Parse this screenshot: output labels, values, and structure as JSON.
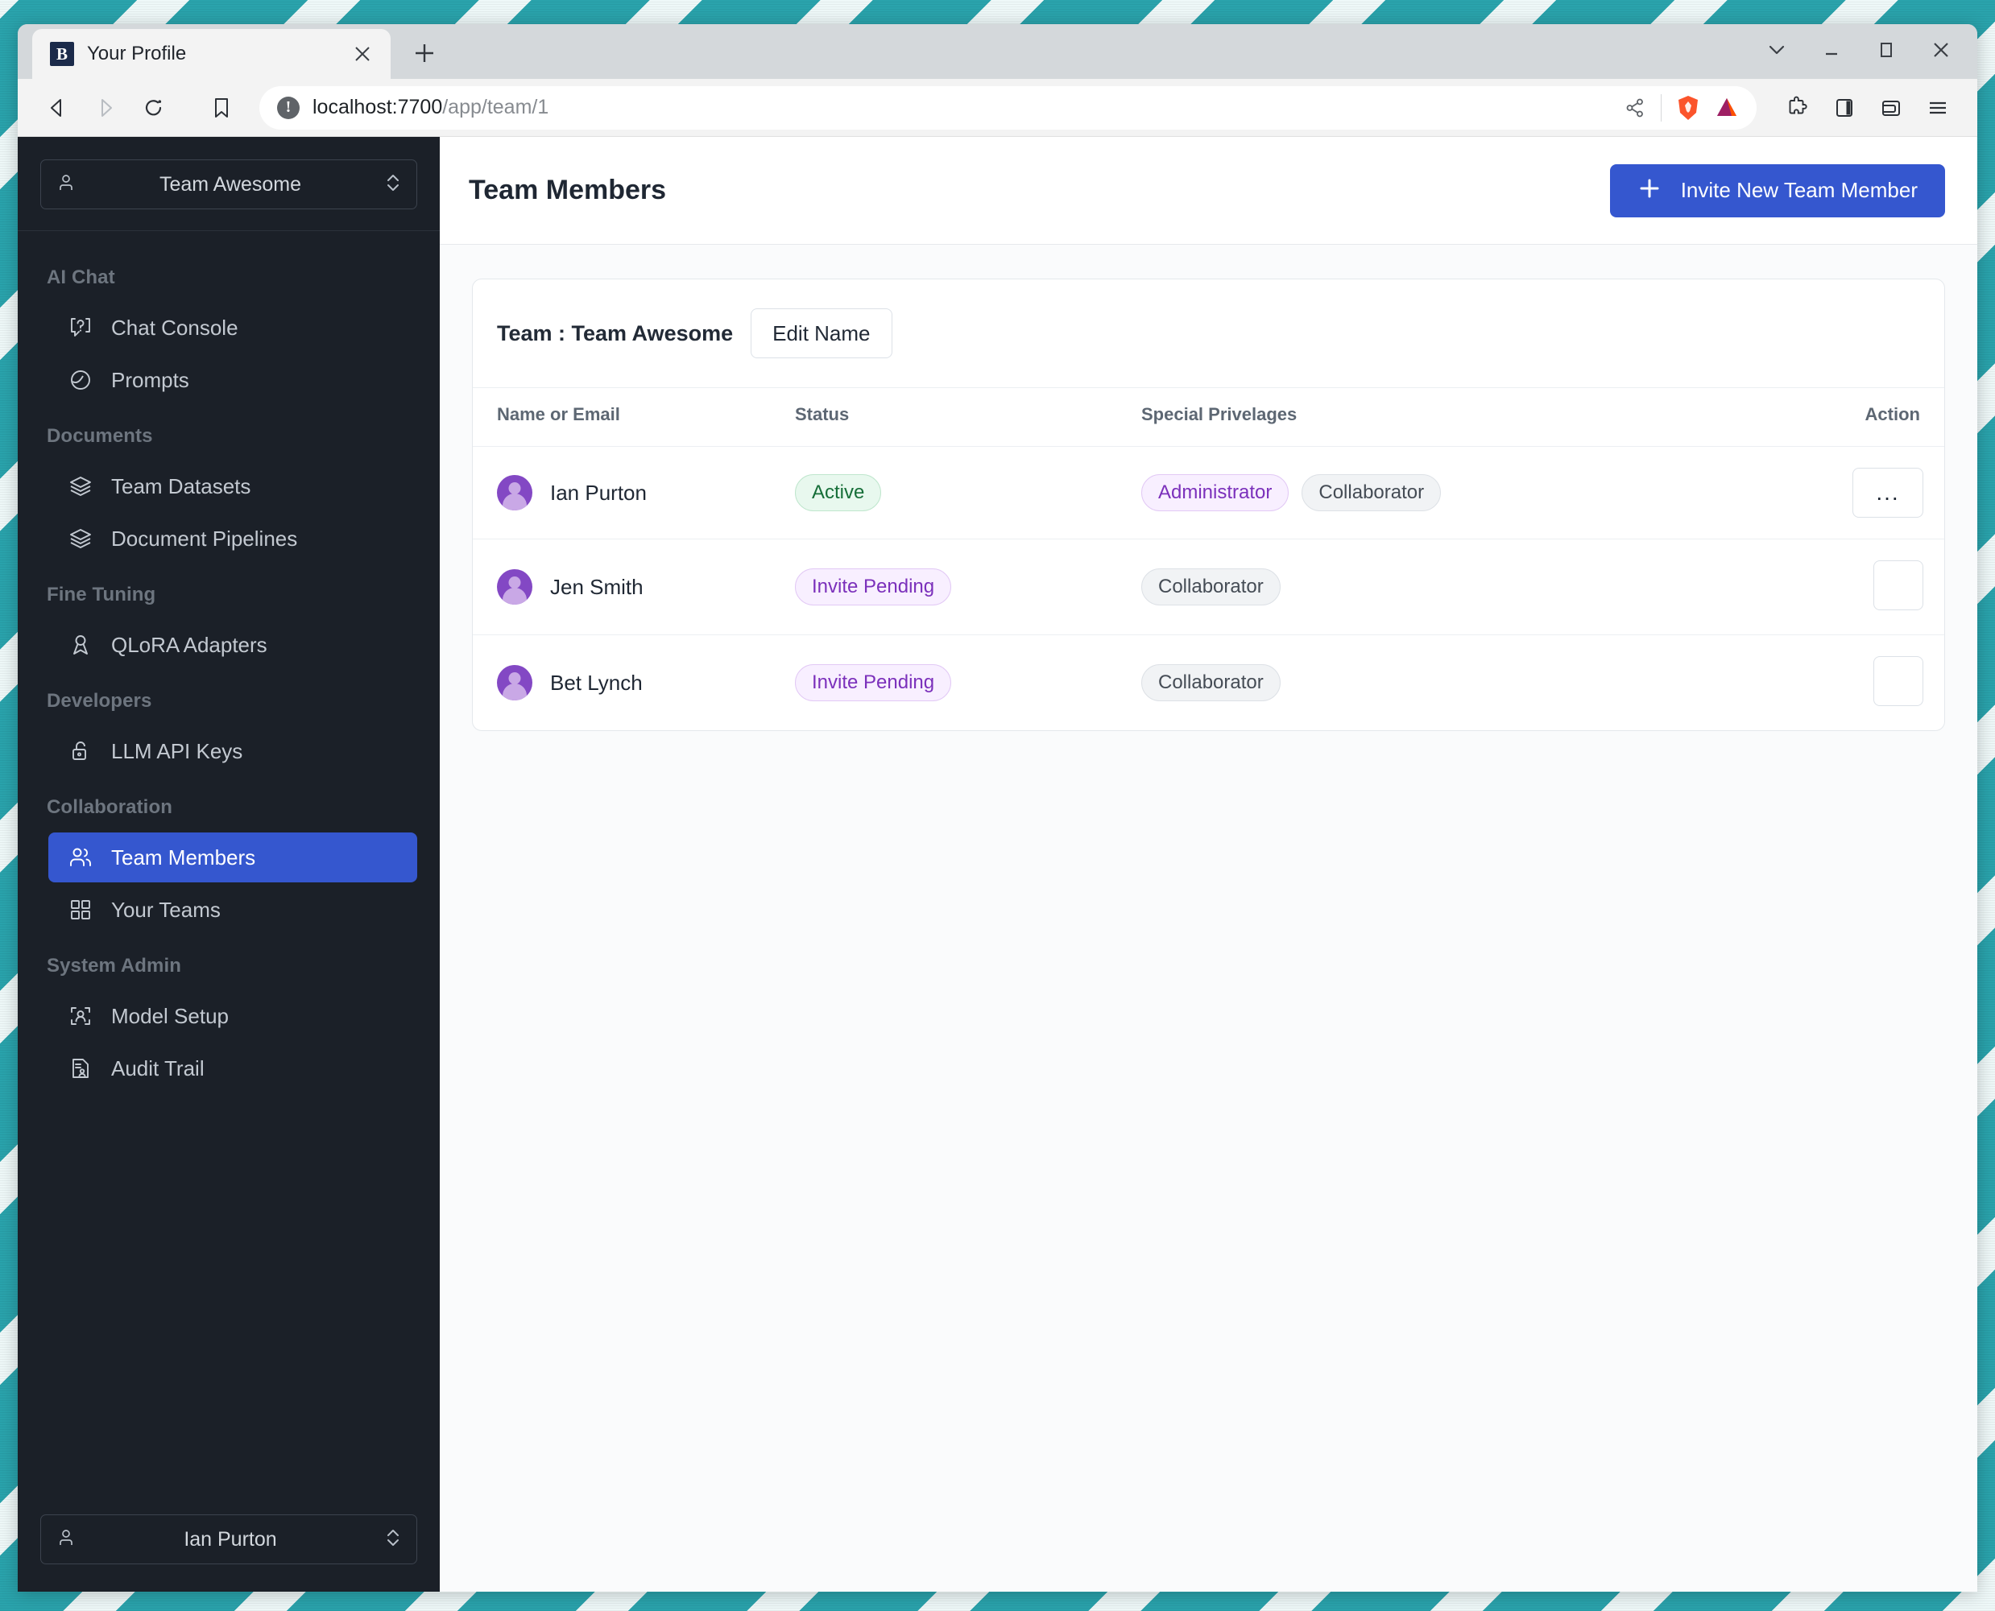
{
  "browser": {
    "tab": {
      "title": "Your Profile",
      "favicon_letter": "B",
      "close_icon": "close-icon"
    },
    "new_tab_label": "+",
    "url": {
      "host": "localhost:7700",
      "path": "/app/team/1",
      "security_icon": "not-secure-icon"
    },
    "window_controls": {
      "minimize": "–",
      "maximize": "□",
      "close": "✕",
      "tab_search": "⌄"
    }
  },
  "sidebar": {
    "team_selector": {
      "label": "Team Awesome",
      "icon": "person-icon"
    },
    "sections": [
      {
        "title": "AI Chat",
        "items": [
          {
            "label": "Chat Console",
            "icon": "chat-question-icon",
            "active": false
          },
          {
            "label": "Prompts",
            "icon": "prompt-circle-icon",
            "active": false
          }
        ]
      },
      {
        "title": "Documents",
        "items": [
          {
            "label": "Team Datasets",
            "icon": "layers-icon",
            "active": false
          },
          {
            "label": "Document Pipelines",
            "icon": "layers-icon",
            "active": false
          }
        ]
      },
      {
        "title": "Fine Tuning",
        "items": [
          {
            "label": "QLoRA Adapters",
            "icon": "ribbon-icon",
            "active": false
          }
        ]
      },
      {
        "title": "Developers",
        "items": [
          {
            "label": "LLM API Keys",
            "icon": "unlock-icon",
            "active": false
          }
        ]
      },
      {
        "title": "Collaboration",
        "items": [
          {
            "label": "Team Members",
            "icon": "users-icon",
            "active": true
          },
          {
            "label": "Your Teams",
            "icon": "grid-icon",
            "active": false
          }
        ]
      },
      {
        "title": "System Admin",
        "items": [
          {
            "label": "Model Setup",
            "icon": "scan-person-icon",
            "active": false
          },
          {
            "label": "Audit Trail",
            "icon": "document-person-icon",
            "active": false
          }
        ]
      }
    ],
    "user_selector": {
      "label": "Ian Purton",
      "icon": "person-icon"
    }
  },
  "main": {
    "page_title": "Team Members",
    "invite_button": {
      "label": "Invite New Team Member",
      "icon": "plus-icon"
    },
    "card": {
      "team_label": "Team : Team Awesome",
      "edit_name_button": "Edit Name",
      "columns": [
        "Name or Email",
        "Status",
        "Special Privelages",
        "Action"
      ],
      "rows": [
        {
          "name": "Ian Purton",
          "avatar": "user-avatar",
          "status": {
            "label": "Active",
            "tone": "green"
          },
          "privileges": [
            {
              "label": "Administrator",
              "tone": "purple"
            },
            {
              "label": "Collaborator",
              "tone": "gray"
            }
          ],
          "action": {
            "label": "...",
            "wide": true
          }
        },
        {
          "name": "Jen Smith",
          "avatar": "user-avatar",
          "status": {
            "label": "Invite Pending",
            "tone": "purple"
          },
          "privileges": [
            {
              "label": "Collaborator",
              "tone": "gray"
            }
          ],
          "action": {
            "label": "",
            "wide": false
          }
        },
        {
          "name": "Bet Lynch",
          "avatar": "user-avatar",
          "status": {
            "label": "Invite Pending",
            "tone": "purple"
          },
          "privileges": [
            {
              "label": "Collaborator",
              "tone": "gray"
            }
          ],
          "action": {
            "label": "",
            "wide": false
          }
        }
      ]
    }
  },
  "colors": {
    "accent": "#3557cf",
    "sidebar_bg": "#1b2028",
    "desktop": "#2aa3ac",
    "badge_green": "#166e38",
    "badge_purple": "#7b30bb"
  }
}
